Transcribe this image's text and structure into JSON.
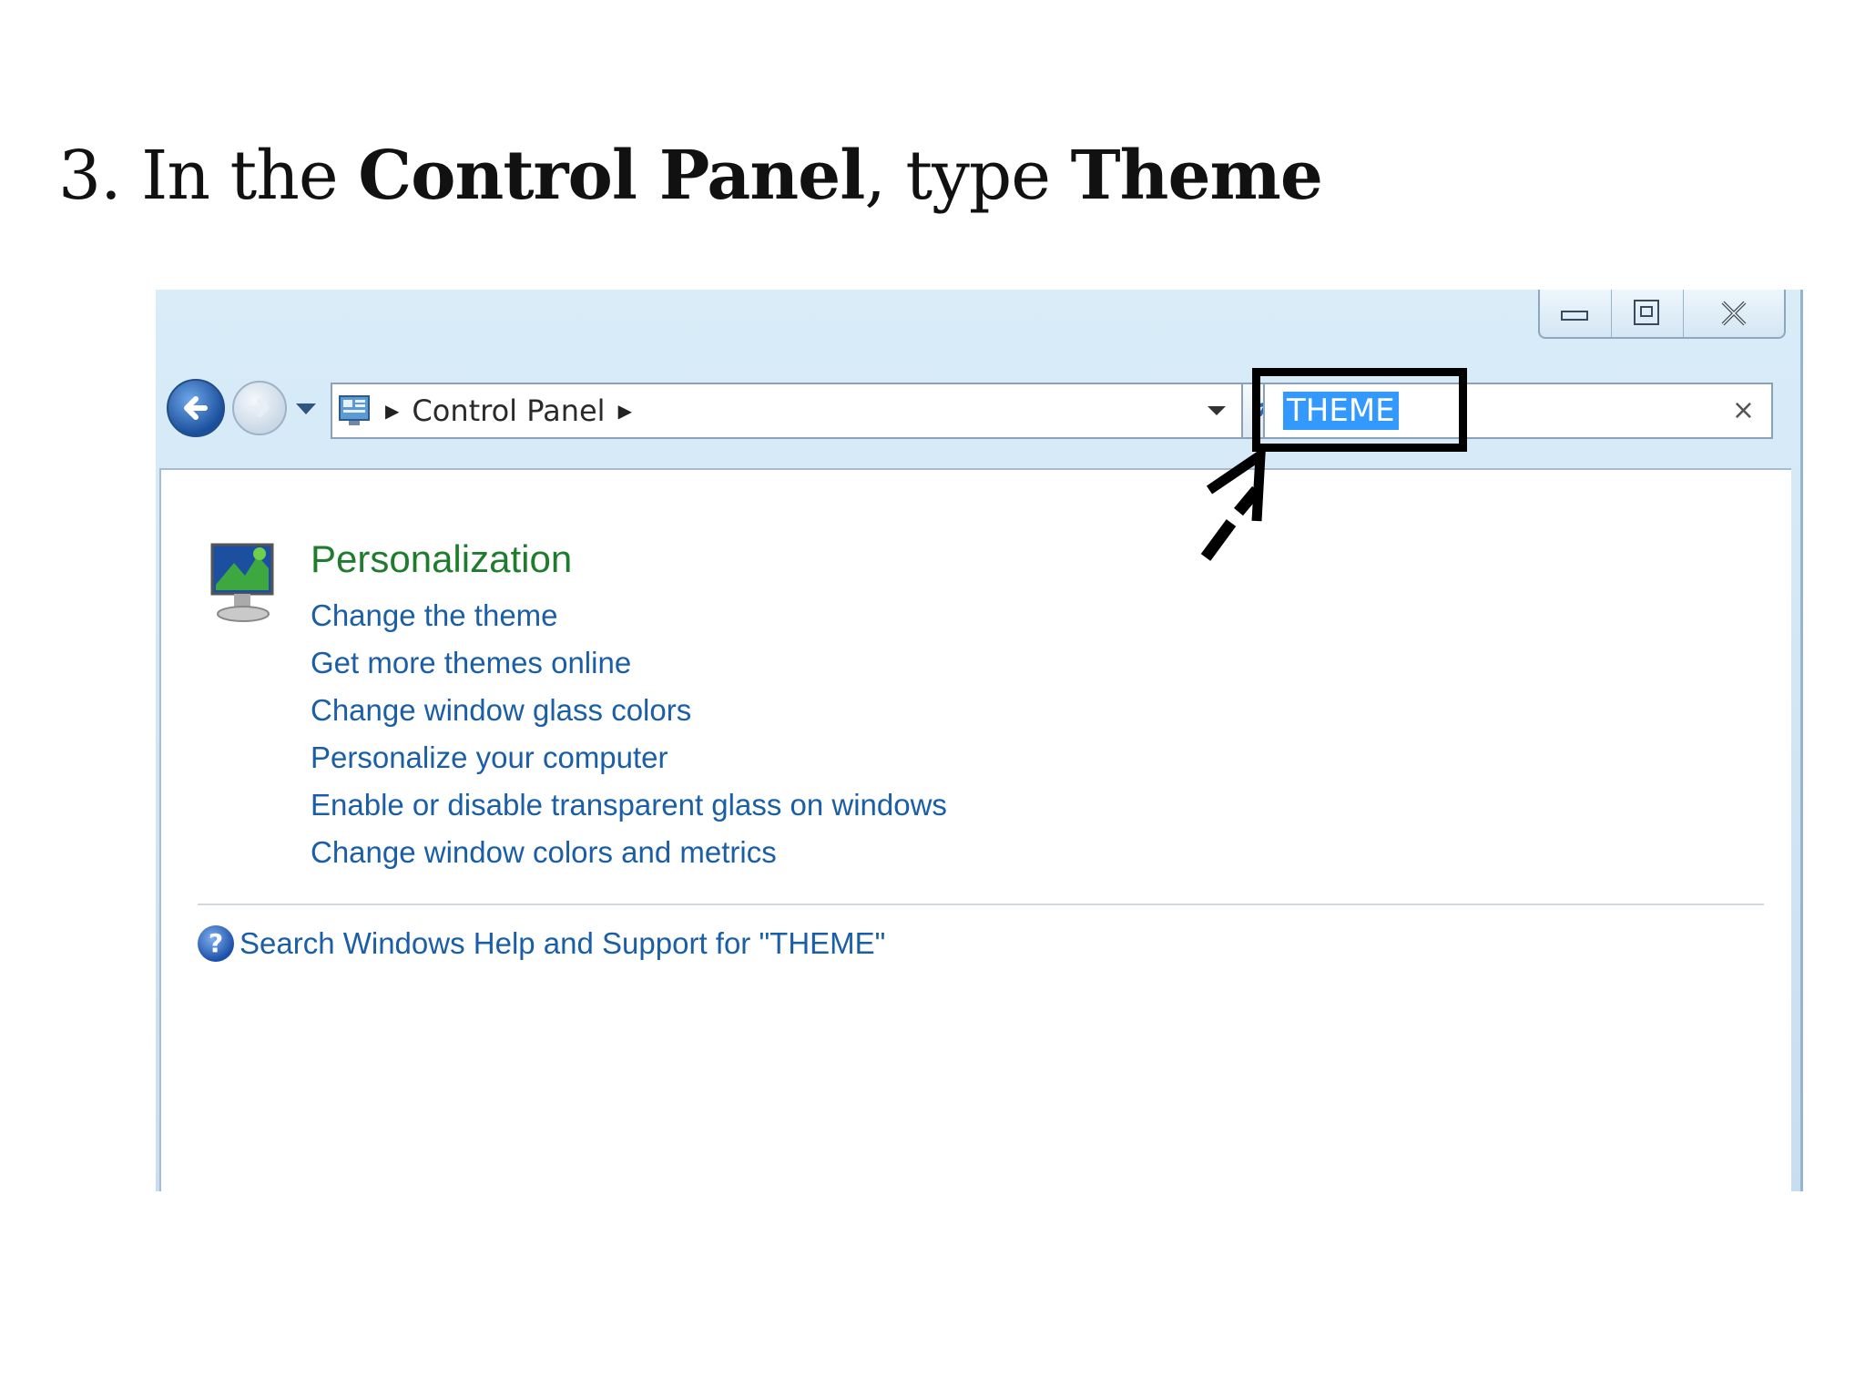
{
  "heading": {
    "prefix": "3. In the ",
    "bold1": "Control Panel",
    "middle": ", type ",
    "bold2": "Theme"
  },
  "window": {
    "controls": {
      "minimize_icon": "minimize-icon",
      "maximize_icon": "maximize-icon",
      "close_icon": "close-icon"
    },
    "address": {
      "crumb": "Control Panel"
    },
    "search": {
      "value": "THEME",
      "clear": "×"
    }
  },
  "results": {
    "category_title": "Personalization",
    "links": [
      "Change the theme",
      "Get more themes online",
      "Change window glass colors",
      "Personalize your computer",
      "Enable or disable transparent glass on windows",
      "Change window colors and metrics"
    ],
    "help_icon_text": "?",
    "help_link": "Search Windows Help and Support for \"THEME\""
  },
  "colors": {
    "link": "#1a5ea8",
    "category": "#1e7c2c",
    "selection": "#3399ff"
  }
}
